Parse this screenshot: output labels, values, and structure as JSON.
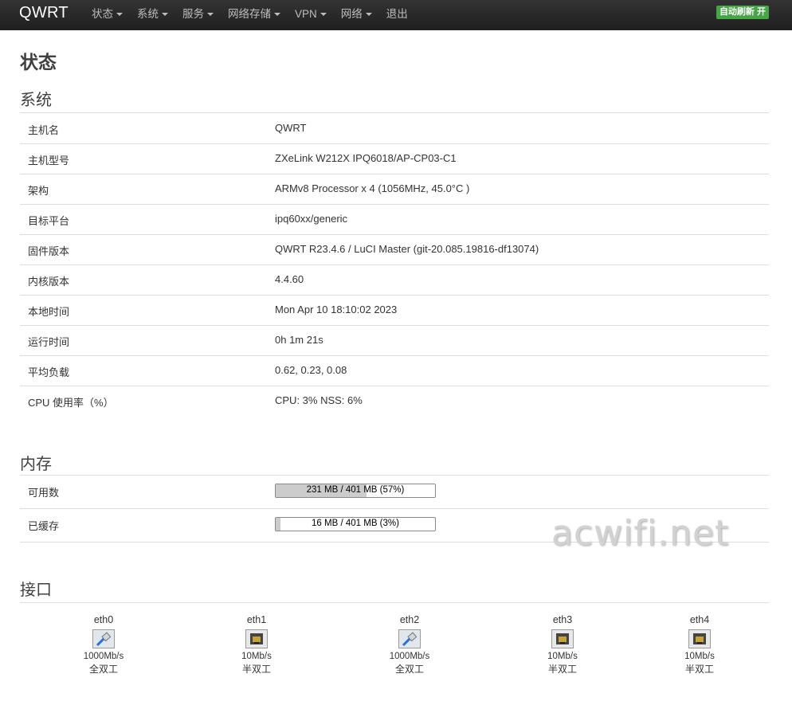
{
  "nav": {
    "brand": "QWRT",
    "menu": [
      {
        "label": "状态",
        "caret": true
      },
      {
        "label": "系统",
        "caret": true
      },
      {
        "label": "服务",
        "caret": true
      },
      {
        "label": "网络存储",
        "caret": true
      },
      {
        "label": "VPN",
        "caret": true
      },
      {
        "label": "网络",
        "caret": true
      },
      {
        "label": "退出",
        "caret": false
      }
    ],
    "refresh_label": "自动刷新 开",
    "refresh_color": "#46a546"
  },
  "page_title": "状态",
  "system": {
    "heading": "系统",
    "rows": [
      {
        "key": "主机名",
        "value": "QWRT"
      },
      {
        "key": "主机型号",
        "value": "ZXeLink W212X IPQ6018/AP-CP03-C1"
      },
      {
        "key": "架构",
        "value": "ARMv8 Processor x 4 (1056MHz, 45.0°C )"
      },
      {
        "key": "目标平台",
        "value": "ipq60xx/generic"
      },
      {
        "key": "固件版本",
        "value": "QWRT R23.4.6 / LuCI Master (git-20.085.19816-df13074)"
      },
      {
        "key": "内核版本",
        "value": "4.4.60"
      },
      {
        "key": "本地时间",
        "value": "Mon Apr 10 18:10:02 2023"
      },
      {
        "key": "运行时间",
        "value": "0h 1m 21s"
      },
      {
        "key": "平均负载",
        "value": "0.62, 0.23, 0.08"
      },
      {
        "key": "CPU 使用率（%）",
        "value": "CPU: 3% NSS: 6%"
      }
    ]
  },
  "memory": {
    "heading": "内存",
    "rows": [
      {
        "key": "可用数",
        "label": "231 MB / 401 MB (57%)",
        "fraction": 0.57
      },
      {
        "key": "已缓存",
        "label": "16 MB / 401 MB (3%)",
        "fraction": 0.03
      }
    ]
  },
  "interfaces": {
    "heading": "接口",
    "ports": [
      {
        "name": "eth0",
        "speed": "1000Mb/s",
        "duplex": "全双工",
        "connected": true
      },
      {
        "name": "eth1",
        "speed": "10Mb/s",
        "duplex": "半双工",
        "connected": false
      },
      {
        "name": "eth2",
        "speed": "1000Mb/s",
        "duplex": "全双工",
        "connected": true
      },
      {
        "name": "eth3",
        "speed": "10Mb/s",
        "duplex": "半双工",
        "connected": false
      },
      {
        "name": "eth4",
        "speed": "10Mb/s",
        "duplex": "半双工",
        "connected": false
      }
    ]
  },
  "watermark": "acwifi.net"
}
